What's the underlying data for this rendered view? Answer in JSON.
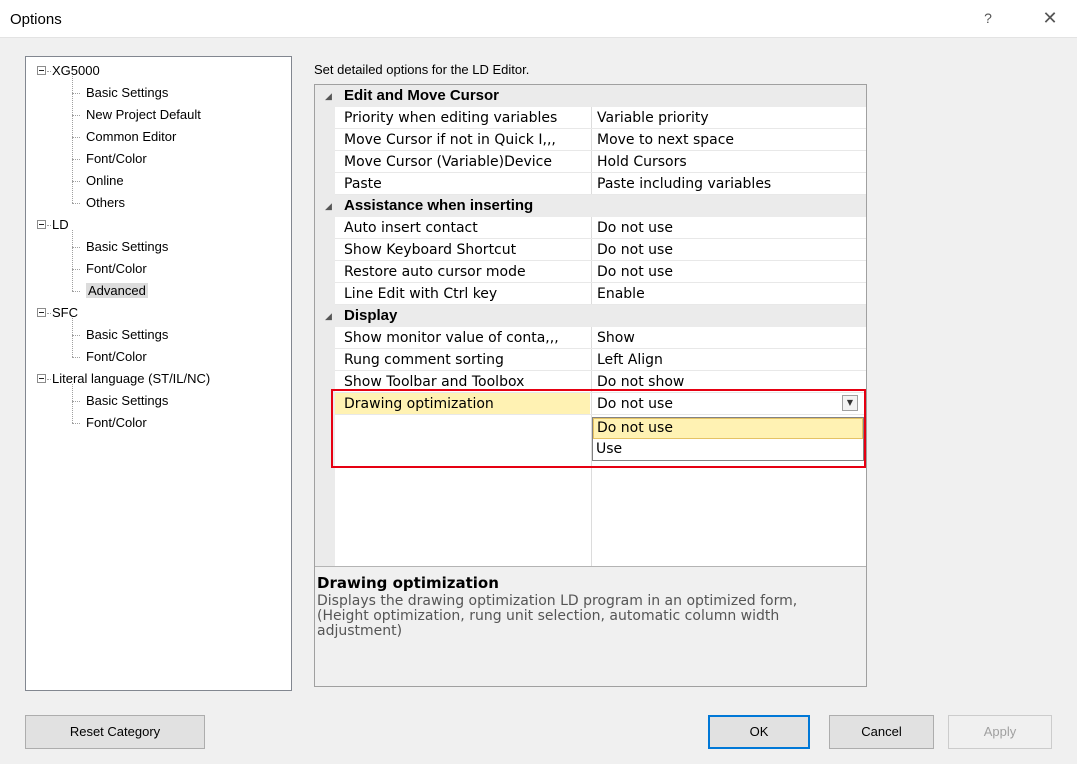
{
  "window": {
    "title": "Options",
    "help": "?",
    "close": "✕"
  },
  "tree": [
    {
      "label": "XG5000",
      "level": 0,
      "expander": true
    },
    {
      "label": "Basic Settings",
      "level": 1
    },
    {
      "label": "New Project Default",
      "level": 1
    },
    {
      "label": "Common Editor",
      "level": 1
    },
    {
      "label": "Font/Color",
      "level": 1
    },
    {
      "label": "Online",
      "level": 1
    },
    {
      "label": "Others",
      "level": 1
    },
    {
      "label": "LD",
      "level": 0,
      "expander": true
    },
    {
      "label": "Basic Settings",
      "level": 1
    },
    {
      "label": "Font/Color",
      "level": 1
    },
    {
      "label": "Advanced",
      "level": 1,
      "selected": true
    },
    {
      "label": "SFC",
      "level": 0,
      "expander": true
    },
    {
      "label": "Basic Settings",
      "level": 1
    },
    {
      "label": "Font/Color",
      "level": 1
    },
    {
      "label": "Literal language (ST/IL/NC)",
      "level": 0,
      "expander": true
    },
    {
      "label": "Basic Settings",
      "level": 1
    },
    {
      "label": "Font/Color",
      "level": 1
    }
  ],
  "description_label": "Set detailed options for the LD Editor.",
  "grid": {
    "categories": [
      {
        "label": "Edit and Move Cursor",
        "rows": [
          {
            "name": "Priority when editing variables",
            "value": "Variable priority"
          },
          {
            "name": "Move Cursor if not in Quick I,,,",
            "value": "Move to next space"
          },
          {
            "name": "Move Cursor (Variable)Device",
            "value": "Hold Cursors"
          },
          {
            "name": "Paste",
            "value": "Paste including variables"
          }
        ]
      },
      {
        "label": "Assistance when inserting",
        "rows": [
          {
            "name": "Auto insert contact",
            "value": "Do not use"
          },
          {
            "name": "Show Keyboard Shortcut",
            "value": "Do not use"
          },
          {
            "name": "Restore auto cursor mode",
            "value": "Do not use"
          },
          {
            "name": "Line Edit with Ctrl key",
            "value": "Enable"
          }
        ]
      },
      {
        "label": "Display",
        "rows": [
          {
            "name": "Show monitor value of conta,,,",
            "value": "Show"
          },
          {
            "name": "Rung comment sorting",
            "value": "Left Align"
          },
          {
            "name": "Show Toolbar and Toolbox",
            "value": "Do not show"
          },
          {
            "name": "Drawing optimization",
            "value": "Do not use",
            "selected": true
          }
        ]
      }
    ],
    "dropdown_options": [
      "Do not use",
      "Use"
    ],
    "dropdown_highlighted": "Do not use"
  },
  "help_panel": {
    "title": "Drawing optimization",
    "text": "Displays the drawing optimization LD program in an optimized form,\n(Height optimization, rung unit selection, automatic column width adjustment)"
  },
  "buttons": {
    "reset": "Reset Category",
    "ok": "OK",
    "cancel": "Cancel",
    "apply": "Apply"
  },
  "colors": {
    "highlight": "#fff2b3",
    "annotation_red": "#e60012",
    "default_button_border": "#0078d7"
  }
}
